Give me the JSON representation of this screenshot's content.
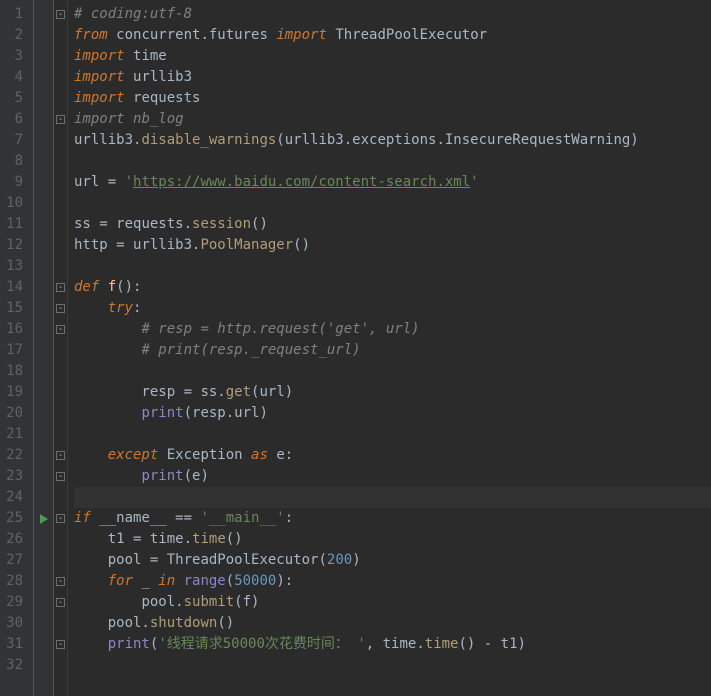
{
  "editor": {
    "lineCount": 32,
    "caretLine": 24,
    "playMarkLine": 25,
    "foldMarkers": {
      "1": "open",
      "6": "open",
      "14": "open",
      "15": "open",
      "16": "open",
      "22": "open",
      "23": "close",
      "25": "open",
      "28": "open",
      "29": "close",
      "31": "close"
    },
    "lines": {
      "1": [
        {
          "cls": "c-comment",
          "t": "# coding:utf-8"
        }
      ],
      "2": [
        {
          "cls": "c-kw",
          "t": "from "
        },
        {
          "cls": "c-ident",
          "t": "concurrent.futures "
        },
        {
          "cls": "c-kw",
          "t": "import "
        },
        {
          "cls": "c-ident",
          "t": "ThreadPoolExecutor"
        }
      ],
      "3": [
        {
          "cls": "c-kw",
          "t": "import "
        },
        {
          "cls": "c-ident",
          "t": "time"
        }
      ],
      "4": [
        {
          "cls": "c-kw",
          "t": "import "
        },
        {
          "cls": "c-ident",
          "t": "urllib3"
        }
      ],
      "5": [
        {
          "cls": "c-kw",
          "t": "import "
        },
        {
          "cls": "c-ident",
          "t": "requests"
        }
      ],
      "6": [
        {
          "cls": "c-unused",
          "t": "import "
        },
        {
          "cls": "c-unused",
          "t": "nb_log"
        }
      ],
      "7": [
        {
          "cls": "c-ident",
          "t": "urllib3."
        },
        {
          "cls": "c-call",
          "t": "disable_warnings"
        },
        {
          "cls": "c-ident",
          "t": "(urllib3.exceptions.InsecureRequestWarning)"
        }
      ],
      "8": [
        {
          "cls": "c-ident",
          "t": ""
        }
      ],
      "9": [
        {
          "cls": "c-ident",
          "t": "url "
        },
        {
          "cls": "c-op",
          "t": "= "
        },
        {
          "cls": "c-str",
          "t": "'"
        },
        {
          "cls": "c-url",
          "t": "https://www.baidu.com/content-search.xml"
        },
        {
          "cls": "c-str",
          "t": "'"
        }
      ],
      "10": [
        {
          "cls": "c-ident",
          "t": ""
        }
      ],
      "11": [
        {
          "cls": "c-ident",
          "t": "ss "
        },
        {
          "cls": "c-op",
          "t": "= "
        },
        {
          "cls": "c-ident",
          "t": "requests."
        },
        {
          "cls": "c-call",
          "t": "session"
        },
        {
          "cls": "c-ident",
          "t": "()"
        }
      ],
      "12": [
        {
          "cls": "c-ident",
          "t": "http "
        },
        {
          "cls": "c-op",
          "t": "= "
        },
        {
          "cls": "c-ident",
          "t": "urllib3."
        },
        {
          "cls": "c-call",
          "t": "PoolManager"
        },
        {
          "cls": "c-ident",
          "t": "()"
        }
      ],
      "13": [
        {
          "cls": "c-ident",
          "t": ""
        }
      ],
      "14": [
        {
          "cls": "c-kw",
          "t": "def "
        },
        {
          "cls": "c-func",
          "t": "f"
        },
        {
          "cls": "c-ident",
          "t": "()"
        },
        {
          "cls": "c-op",
          "t": ":"
        }
      ],
      "15": [
        {
          "cls": "indent",
          "t": "    "
        },
        {
          "cls": "c-kw",
          "t": "try"
        },
        {
          "cls": "c-op",
          "t": ":"
        }
      ],
      "16": [
        {
          "cls": "indent",
          "t": "        "
        },
        {
          "cls": "c-comment",
          "t": "# resp = http.request('get', url)"
        }
      ],
      "17": [
        {
          "cls": "indent",
          "t": "        "
        },
        {
          "cls": "c-comment",
          "t": "# print(resp._request_url)"
        }
      ],
      "18": [
        {
          "cls": "c-ident",
          "t": ""
        }
      ],
      "19": [
        {
          "cls": "indent",
          "t": "        "
        },
        {
          "cls": "c-ident",
          "t": "resp "
        },
        {
          "cls": "c-op",
          "t": "= "
        },
        {
          "cls": "c-ident",
          "t": "ss."
        },
        {
          "cls": "c-call",
          "t": "get"
        },
        {
          "cls": "c-ident",
          "t": "(url)"
        }
      ],
      "20": [
        {
          "cls": "indent",
          "t": "        "
        },
        {
          "cls": "c-builtin",
          "t": "print"
        },
        {
          "cls": "c-ident",
          "t": "(resp.url)"
        }
      ],
      "21": [
        {
          "cls": "c-ident",
          "t": ""
        }
      ],
      "22": [
        {
          "cls": "indent",
          "t": "    "
        },
        {
          "cls": "c-kw",
          "t": "except "
        },
        {
          "cls": "c-ident",
          "t": "Exception "
        },
        {
          "cls": "c-kw",
          "t": "as "
        },
        {
          "cls": "c-ident",
          "t": "e"
        },
        {
          "cls": "c-op",
          "t": ":"
        }
      ],
      "23": [
        {
          "cls": "indent",
          "t": "        "
        },
        {
          "cls": "c-builtin",
          "t": "print"
        },
        {
          "cls": "c-ident",
          "t": "(e)"
        }
      ],
      "24": [
        {
          "cls": "c-ident",
          "t": ""
        }
      ],
      "25": [
        {
          "cls": "c-kw",
          "t": "if "
        },
        {
          "cls": "c-ident",
          "t": "__name__ "
        },
        {
          "cls": "c-op",
          "t": "== "
        },
        {
          "cls": "c-str",
          "t": "'__main__'"
        },
        {
          "cls": "c-op",
          "t": ":"
        }
      ],
      "26": [
        {
          "cls": "indent",
          "t": "    "
        },
        {
          "cls": "c-ident",
          "t": "t1 "
        },
        {
          "cls": "c-op",
          "t": "= "
        },
        {
          "cls": "c-ident",
          "t": "time."
        },
        {
          "cls": "c-call",
          "t": "time"
        },
        {
          "cls": "c-ident",
          "t": "()"
        }
      ],
      "27": [
        {
          "cls": "indent",
          "t": "    "
        },
        {
          "cls": "c-ident",
          "t": "pool "
        },
        {
          "cls": "c-op",
          "t": "= "
        },
        {
          "cls": "c-ident",
          "t": "ThreadPoolExecutor("
        },
        {
          "cls": "c-num",
          "t": "200"
        },
        {
          "cls": "c-ident",
          "t": ")"
        }
      ],
      "28": [
        {
          "cls": "indent",
          "t": "    "
        },
        {
          "cls": "c-kw",
          "t": "for "
        },
        {
          "cls": "c-ident",
          "t": "_ "
        },
        {
          "cls": "c-kw",
          "t": "in "
        },
        {
          "cls": "c-builtin",
          "t": "range"
        },
        {
          "cls": "c-ident",
          "t": "("
        },
        {
          "cls": "c-num",
          "t": "50000"
        },
        {
          "cls": "c-ident",
          "t": ")"
        },
        {
          "cls": "c-op",
          "t": ":"
        }
      ],
      "29": [
        {
          "cls": "indent",
          "t": "        "
        },
        {
          "cls": "c-ident",
          "t": "pool."
        },
        {
          "cls": "c-call",
          "t": "submit"
        },
        {
          "cls": "c-ident",
          "t": "(f)"
        }
      ],
      "30": [
        {
          "cls": "indent",
          "t": "    "
        },
        {
          "cls": "c-ident",
          "t": "pool."
        },
        {
          "cls": "c-call",
          "t": "shutdown"
        },
        {
          "cls": "c-ident",
          "t": "()"
        }
      ],
      "31": [
        {
          "cls": "indent",
          "t": "    "
        },
        {
          "cls": "c-builtin",
          "t": "print"
        },
        {
          "cls": "c-ident",
          "t": "("
        },
        {
          "cls": "c-str",
          "t": "'线程请求50000次花费时间："
        },
        {
          "cls": "c-str",
          "t": " '"
        },
        {
          "cls": "c-op",
          "t": ", "
        },
        {
          "cls": "c-ident",
          "t": "time."
        },
        {
          "cls": "c-call",
          "t": "time"
        },
        {
          "cls": "c-ident",
          "t": "() "
        },
        {
          "cls": "c-op",
          "t": "- "
        },
        {
          "cls": "c-ident",
          "t": "t1)"
        }
      ],
      "32": [
        {
          "cls": "c-ident",
          "t": ""
        }
      ]
    }
  }
}
